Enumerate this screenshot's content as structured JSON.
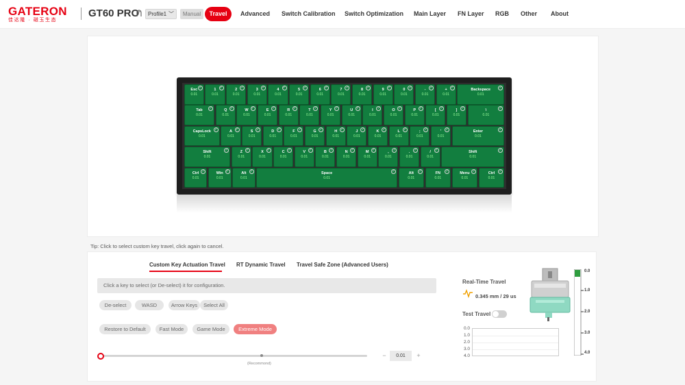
{
  "header": {
    "brand": "GATERON",
    "brand_sub": "佳达隆 · 磁玉生态",
    "device": "GT60 PRO",
    "profile": "Profile1",
    "manual": "Manual",
    "nav": [
      "Travel",
      "Advanced",
      "Switch Calibration",
      "Switch Optimization",
      "Main Layer",
      "FN Layer",
      "RGB",
      "Other",
      "About"
    ],
    "active_nav": "Travel"
  },
  "keyboard": {
    "key_value": "0.01",
    "key_selected": true,
    "rows": [
      [
        "Esc",
        "1",
        "2",
        "3",
        "4",
        "5",
        "6",
        "7",
        "8",
        "9",
        "0",
        "-",
        "+",
        "Backspace"
      ],
      [
        "Tab",
        "Q",
        "W",
        "E",
        "R",
        "T",
        "Y",
        "U",
        "I",
        "O",
        "P",
        "[",
        "]",
        "\\"
      ],
      [
        "CapsLock",
        "A",
        "S",
        "D",
        "F",
        "G",
        "H",
        "J",
        "K",
        "L",
        ";",
        "'",
        "Enter"
      ],
      [
        "Shift",
        "Z",
        "X",
        "C",
        "V",
        "B",
        "N",
        "M",
        ",",
        ".",
        "/",
        "Shift"
      ],
      [
        "Ctrl",
        "Win",
        "Alt",
        "Space",
        "Alt",
        "FN",
        "Menu",
        "Ctrl"
      ]
    ]
  },
  "tip": "Tip: Click to select custom key travel, click again to cancel.",
  "tabs": [
    "Custom Key Actuation Travel",
    "RT Dynamic Travel",
    "Travel Safe Zone (Advanced Users)"
  ],
  "active_tab": "Custom Key Actuation Travel",
  "hint": "Click a key to select (or De-select) it for configuration.",
  "selection_buttons": [
    "De-select",
    "WASD",
    "Arrow Keys",
    "Select All"
  ],
  "mode_buttons": [
    "Restore to Default",
    "Fast Mode",
    "Game Mode",
    "Extreme Mode"
  ],
  "active_mode": "Extreme Mode",
  "slider": {
    "recommend_label": "(Recommond)",
    "value": "0.01",
    "minus": "−",
    "plus": "+"
  },
  "realtime": {
    "title": "Real-Time Travel",
    "value": "0.345 mm / 29 us",
    "test_travel_label": "Test Travel",
    "test_travel_on": false,
    "graph_labels": [
      "0.0",
      "1.0",
      "2.0",
      "3.0",
      "4.0"
    ],
    "ruler_labels": [
      "0.0",
      "1.0",
      "2.0",
      "3.0",
      "4.0"
    ]
  },
  "colors": {
    "accent": "#e60012",
    "key_green": "#127e3f",
    "extreme_mode": "#f08080"
  }
}
